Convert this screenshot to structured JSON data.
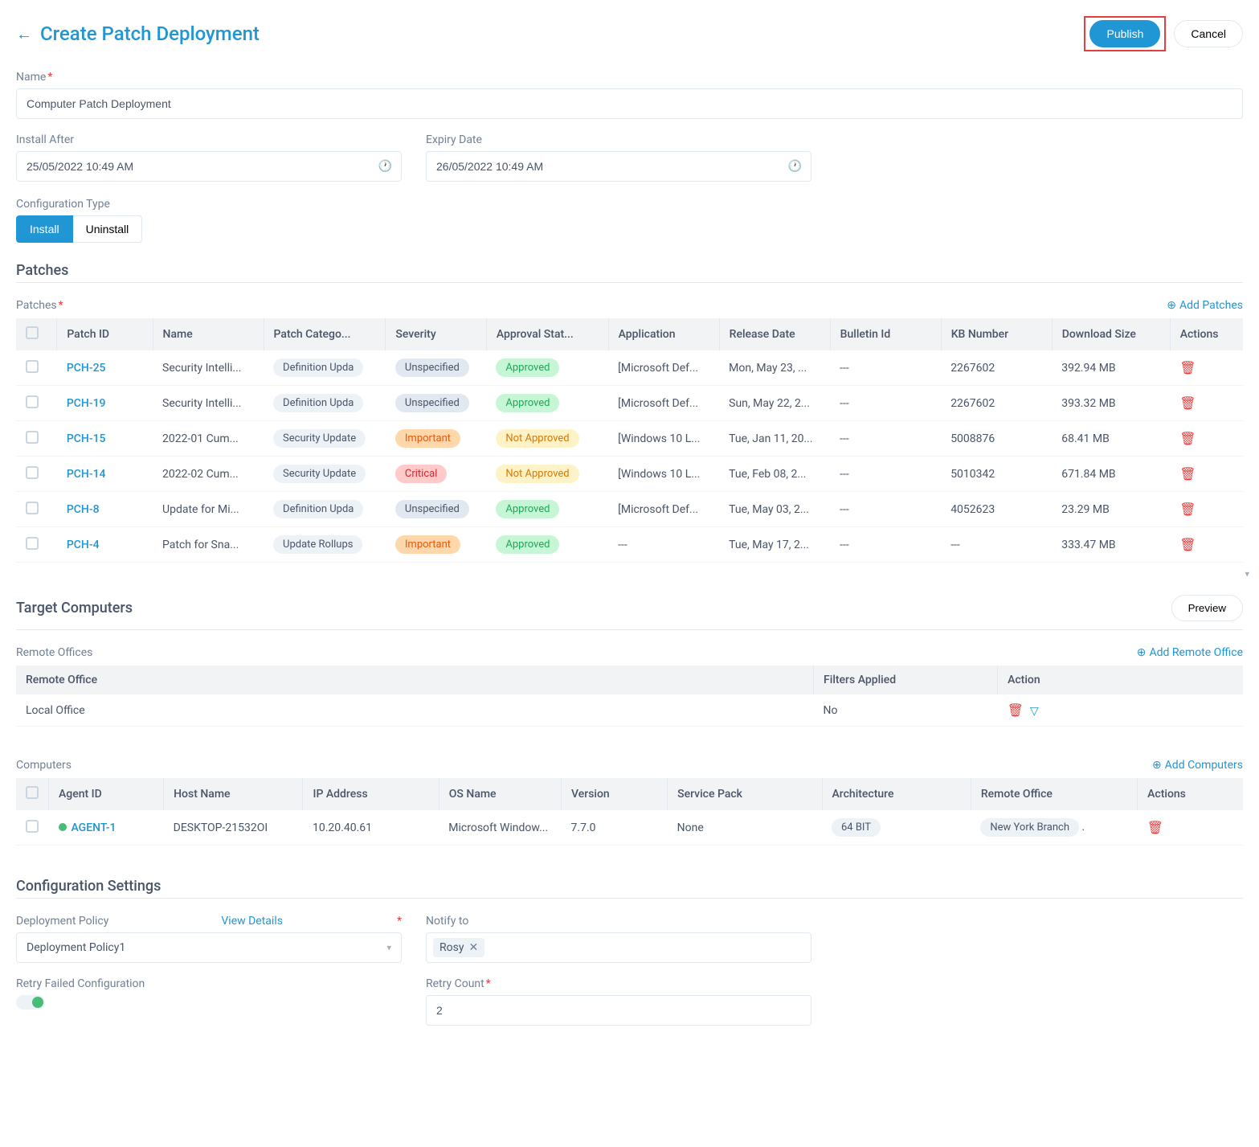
{
  "header": {
    "title": "Create Patch Deployment",
    "publish_label": "Publish",
    "cancel_label": "Cancel"
  },
  "form": {
    "name_label": "Name",
    "name_value": "Computer Patch Deployment",
    "install_after_label": "Install After",
    "install_after_value": "25/05/2022 10:49 AM",
    "expiry_date_label": "Expiry Date",
    "expiry_date_value": "26/05/2022 10:49 AM",
    "config_type_label": "Configuration Type",
    "install_btn": "Install",
    "uninstall_btn": "Uninstall"
  },
  "patches": {
    "section_title": "Patches",
    "subsection_label": "Patches",
    "add_label": "Add Patches",
    "columns": {
      "patch_id": "Patch ID",
      "name": "Name",
      "patch_category": "Patch Catego...",
      "severity": "Severity",
      "approval_status": "Approval Stat...",
      "application": "Application",
      "release_date": "Release Date",
      "bulletin_id": "Bulletin Id",
      "kb_number": "KB Number",
      "download_size": "Download Size",
      "actions": "Actions"
    },
    "rows": [
      {
        "id": "PCH-25",
        "name": "Security Intelli...",
        "category": "Definition Upda",
        "severity": "Unspecified",
        "sev_cls": "badge-gray",
        "approval": "Approved",
        "app_cls": "badge-green",
        "application": "[Microsoft Def...",
        "release": "Mon, May 23, ...",
        "bulletin": "---",
        "kb": "2267602",
        "size": "392.94 MB"
      },
      {
        "id": "PCH-19",
        "name": "Security Intelli...",
        "category": "Definition Upda",
        "severity": "Unspecified",
        "sev_cls": "badge-gray",
        "approval": "Approved",
        "app_cls": "badge-green",
        "application": "[Microsoft Def...",
        "release": "Sun, May 22, 2...",
        "bulletin": "---",
        "kb": "2267602",
        "size": "393.32 MB"
      },
      {
        "id": "PCH-15",
        "name": "2022-01 Cum...",
        "category": "Security Update",
        "severity": "Important",
        "sev_cls": "badge-orange",
        "approval": "Not Approved",
        "app_cls": "badge-yellow",
        "application": "[Windows 10 L...",
        "release": "Tue, Jan 11, 20...",
        "bulletin": "---",
        "kb": "5008876",
        "size": "68.41 MB"
      },
      {
        "id": "PCH-14",
        "name": "2022-02 Cum...",
        "category": "Security Update",
        "severity": "Critical",
        "sev_cls": "badge-red",
        "approval": "Not Approved",
        "app_cls": "badge-yellow",
        "application": "[Windows 10 L...",
        "release": "Tue, Feb 08, 2...",
        "bulletin": "---",
        "kb": "5010342",
        "size": "671.84 MB"
      },
      {
        "id": "PCH-8",
        "name": "Update for Mi...",
        "category": "Definition Upda",
        "severity": "Unspecified",
        "sev_cls": "badge-gray",
        "approval": "Approved",
        "app_cls": "badge-green",
        "application": "[Microsoft Def...",
        "release": "Tue, May 03, 2...",
        "bulletin": "---",
        "kb": "4052623",
        "size": "23.29 MB"
      },
      {
        "id": "PCH-4",
        "name": "Patch for Sna...",
        "category": "Update Rollups",
        "severity": "Important",
        "sev_cls": "badge-orange",
        "approval": "Approved",
        "app_cls": "badge-green",
        "application": "---",
        "release": "Tue, May 17, 2...",
        "bulletin": "---",
        "kb": "---",
        "size": "333.47 MB"
      }
    ]
  },
  "targets": {
    "section_title": "Target Computers",
    "preview_label": "Preview",
    "remote_offices_label": "Remote Offices",
    "add_office_label": "Add Remote Office",
    "ro_columns": {
      "name": "Remote Office",
      "filters": "Filters Applied",
      "action": "Action"
    },
    "ro_rows": [
      {
        "name": "Local Office",
        "filters": "No"
      }
    ],
    "computers_label": "Computers",
    "add_computers_label": "Add Computers",
    "comp_columns": {
      "agent_id": "Agent ID",
      "host": "Host Name",
      "ip": "IP Address",
      "os": "OS Name",
      "version": "Version",
      "sp": "Service Pack",
      "arch": "Architecture",
      "ro": "Remote Office",
      "actions": "Actions"
    },
    "comp_rows": [
      {
        "id": "AGENT-1",
        "host": "DESKTOP-21532OI",
        "ip": "10.20.40.61",
        "os": "Microsoft Window...",
        "version": "7.7.0",
        "sp": "None",
        "arch": "64 BIT",
        "ro": "New York Branch"
      }
    ]
  },
  "config": {
    "section_title": "Configuration Settings",
    "policy_label": "Deployment Policy",
    "view_details": "View Details",
    "policy_value": "Deployment Policy1",
    "notify_label": "Notify to",
    "notify_tag": "Rosy",
    "retry_label": "Retry Failed Configuration",
    "retry_count_label": "Retry Count",
    "retry_count_value": "2"
  }
}
